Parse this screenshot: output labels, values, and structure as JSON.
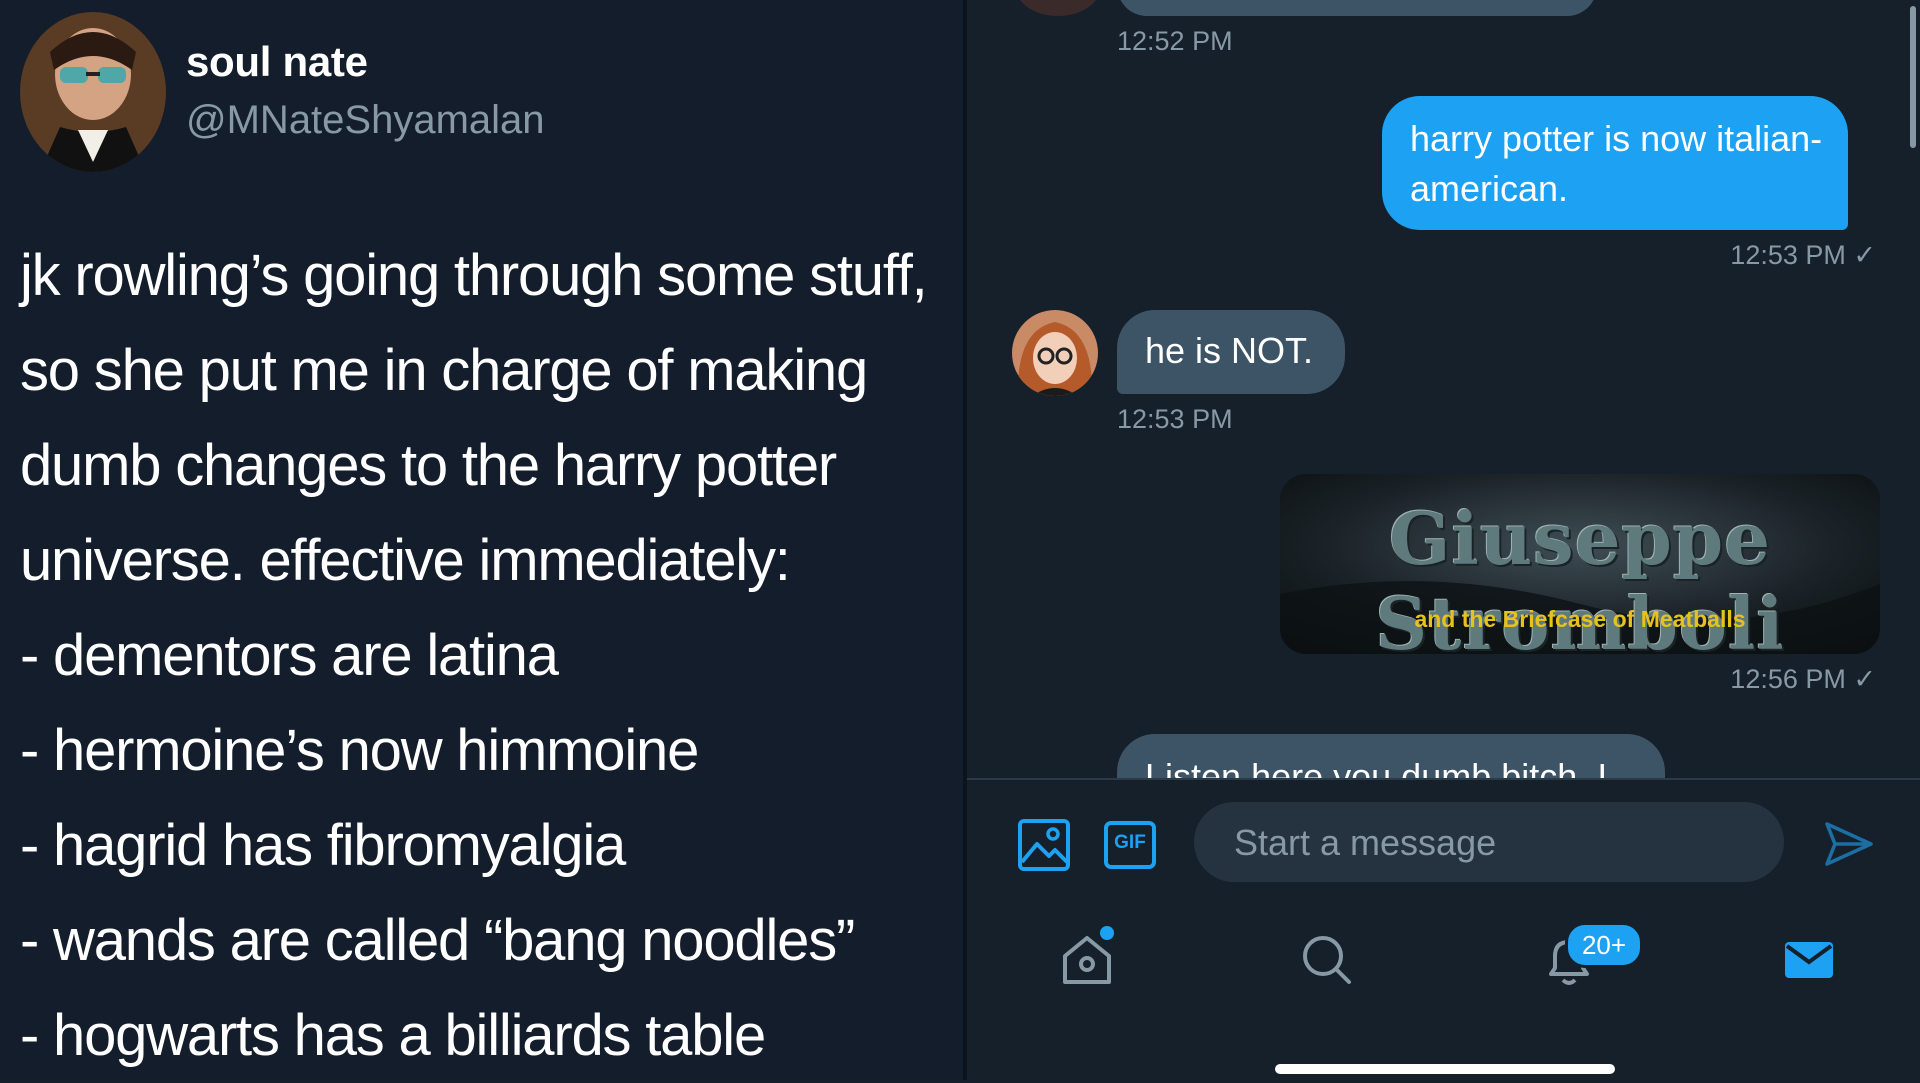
{
  "tweet": {
    "display_name": "soul nate",
    "handle": "@MNateShyamalan",
    "lines": [
      "jk rowling’s going through some stuff,",
      "so she put me in charge of making",
      "dumb changes to the harry potter",
      "universe. effective immediately:",
      "- dementors are latina",
      "- hermoine’s now himmoine",
      "- hagrid has fibromyalgia",
      "- wands are called “bang noodles”",
      "- hogwarts has a billiards table"
    ]
  },
  "dm": {
    "messages": [
      {
        "timestamp": "12:52 PM"
      },
      {
        "text": "harry potter is now italian-american.",
        "timestamp": "12:53 PM ✓"
      },
      {
        "text": "he is NOT.",
        "timestamp": "12:53 PM"
      },
      {
        "image_title": "Giuseppe Stromboli",
        "image_subtitle": "and the Briefcase of Meatballs",
        "timestamp": "12:56 PM ✓"
      },
      {
        "text": "Listen here you dumb bitch, I"
      }
    ],
    "composer": {
      "placeholder": "Start a message",
      "gif_label": "GIF"
    },
    "tabbar": {
      "notifications_badge": "20+"
    }
  },
  "colors": {
    "background": "#15202b",
    "accent": "#1da1f2",
    "bubble_incoming": "#3d5466",
    "muted_text": "#8899a6",
    "banner_subtitle": "#e8c21c"
  },
  "icons": [
    "home-icon",
    "search-icon",
    "notifications-bell-icon",
    "messages-envelope-icon",
    "image-icon",
    "gif-icon",
    "send-icon",
    "read-checkmark-icon"
  ]
}
